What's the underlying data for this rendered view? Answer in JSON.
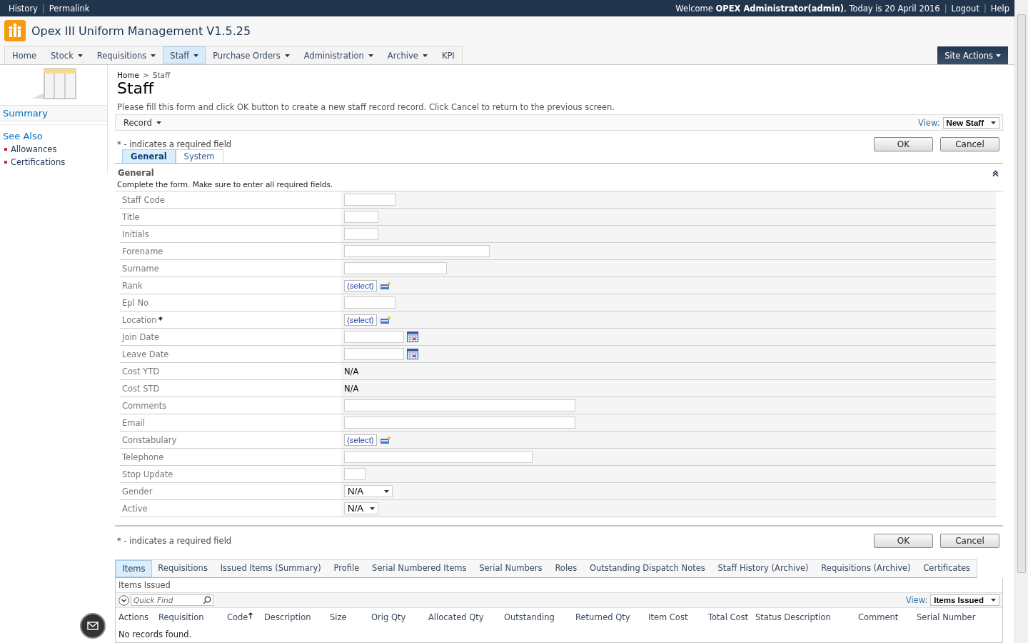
{
  "top_bar": {
    "links": [
      "History",
      "Permalink"
    ],
    "separators": [
      "|",
      "|",
      "|"
    ],
    "welcome_prefix": "Welcome ",
    "user": "OPEX Administrator(admin)",
    "date_text": ", Today is 20 April 2016",
    "right_links": [
      "Logout",
      "Help"
    ]
  },
  "site": {
    "title": "Opex III Uniform Management V1.5.25"
  },
  "nav": [
    {
      "label": "Home",
      "dropdown": false,
      "selected": false
    },
    {
      "label": "Stock",
      "dropdown": true,
      "selected": false
    },
    {
      "label": "Requisitions",
      "dropdown": true,
      "selected": false
    },
    {
      "label": "Staff",
      "dropdown": true,
      "selected": true
    },
    {
      "label": "Purchase Orders",
      "dropdown": true,
      "selected": false
    },
    {
      "label": "Administration",
      "dropdown": true,
      "selected": false
    },
    {
      "label": "Archive",
      "dropdown": true,
      "selected": false
    },
    {
      "label": "KPI",
      "dropdown": false,
      "selected": false
    }
  ],
  "site_actions": "Site Actions",
  "sidebar": {
    "summary": "Summary",
    "see_also": "See Also",
    "links": [
      "Allowances",
      "Certifications"
    ]
  },
  "breadcrumb": [
    "Home",
    "Staff"
  ],
  "breadcrumb_separator": ">",
  "page_title": "Staff",
  "description": "Please fill this form and click OK button to create a new staff record record. Click Cancel to return to the previous screen.",
  "toolbar": {
    "menu": "Record",
    "view_label": "View:",
    "view_value": "New Staff"
  },
  "required_symbol": "*",
  "top_actions": {
    "required_note": "* - indicates a required field",
    "buttons": [
      "OK",
      "Cancel"
    ]
  },
  "form_tabs": [
    {
      "label": "General",
      "selected": true
    },
    {
      "label": "System",
      "selected": false
    }
  ],
  "section": {
    "title": "General",
    "expanded": true,
    "hint": "Complete the form. Make sure to enter all required fields."
  },
  "fields": [
    {
      "label": "Staff Code",
      "kind": "text",
      "required": false
    },
    {
      "label": "Title",
      "kind": "text",
      "required": false
    },
    {
      "label": "Initials",
      "kind": "text",
      "required": false
    },
    {
      "label": "Forename",
      "kind": "text",
      "required": false
    },
    {
      "label": "Surname",
      "kind": "text",
      "required": false
    },
    {
      "label": "Rank",
      "kind": "lookup",
      "value": "(select)",
      "required": false
    },
    {
      "label": "Epl No",
      "kind": "text",
      "required": false
    },
    {
      "label": "Location",
      "kind": "lookup",
      "value": "(select)",
      "required": true
    },
    {
      "label": "Join Date",
      "kind": "date",
      "required": false
    },
    {
      "label": "Leave Date",
      "kind": "date",
      "required": false
    },
    {
      "label": "Cost YTD",
      "kind": "readonly",
      "value": "N/A",
      "required": false
    },
    {
      "label": "Cost STD",
      "kind": "readonly",
      "value": "N/A",
      "required": false
    },
    {
      "label": "Comments",
      "kind": "text",
      "required": false
    },
    {
      "label": "Email",
      "kind": "text",
      "required": false
    },
    {
      "label": "Constabulary",
      "kind": "lookup",
      "value": "(select)",
      "required": false
    },
    {
      "label": "Telephone",
      "kind": "text",
      "required": false
    },
    {
      "label": "Stop Update",
      "kind": "text",
      "required": false
    },
    {
      "label": "Gender",
      "kind": "dropdown",
      "value": "N/A",
      "required": false
    },
    {
      "label": "Active",
      "kind": "dropdown",
      "value": "N/A",
      "required": false
    }
  ],
  "bottom_actions": {
    "required_note": "* - indicates a required field",
    "buttons": [
      "OK",
      "Cancel"
    ]
  },
  "related_tabs": [
    {
      "label": "Items",
      "selected": true
    },
    {
      "label": "Requisitions",
      "selected": false
    },
    {
      "label": "Issued Items (Summary)",
      "selected": false
    },
    {
      "label": "Profile",
      "selected": false
    },
    {
      "label": "Serial Numbered Items",
      "selected": false
    },
    {
      "label": "Serial Numbers",
      "selected": false
    },
    {
      "label": "Roles",
      "selected": false
    },
    {
      "label": "Outstanding Dispatch Notes",
      "selected": false
    },
    {
      "label": "Staff History (Archive)",
      "selected": false
    },
    {
      "label": "Requisitions (Archive)",
      "selected": false
    },
    {
      "label": "Certificates",
      "selected": false
    }
  ],
  "grid": {
    "title": "Items Issued",
    "quick_find": {
      "placeholder": "Quick Find"
    },
    "view_label": "View:",
    "view_value": "Items Issued",
    "columns": [
      {
        "label": "Actions",
        "sorted": false
      },
      {
        "label": "Requisition",
        "sorted": false
      },
      {
        "label": "Code",
        "sorted": true
      },
      {
        "label": "Description",
        "sorted": false
      },
      {
        "label": "Size",
        "sorted": false
      },
      {
        "label": "Orig Qty",
        "sorted": false
      },
      {
        "label": "Allocated Qty",
        "sorted": false
      },
      {
        "label": "Outstanding",
        "sorted": false
      },
      {
        "label": "Returned Qty",
        "sorted": false
      },
      {
        "label": "Item Cost",
        "sorted": false
      },
      {
        "label": "Total Cost",
        "sorted": false
      },
      {
        "label": "Status Description",
        "sorted": false
      },
      {
        "label": "Comment",
        "sorted": false
      },
      {
        "label": "Serial Number",
        "sorted": false
      }
    ],
    "empty_text": "No records found."
  }
}
